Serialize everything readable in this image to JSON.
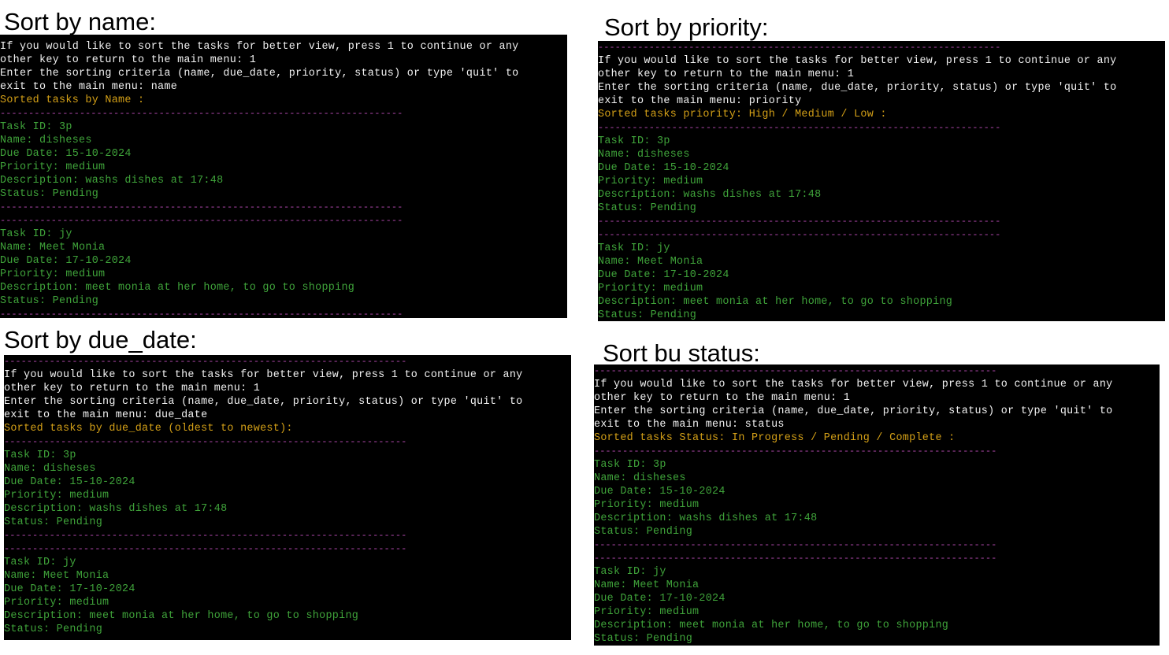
{
  "panels": [
    {
      "id": "name",
      "caption": "Sort by name:",
      "top_separator": false,
      "prompt": [
        "If you would like to sort the tasks for better view, press 1 to continue or any",
        "other key to return to the main menu: 1",
        "Enter the sorting criteria (name, due_date, priority, status) or type 'quit' to",
        "exit to the main menu: name"
      ],
      "header": "Sorted tasks by Name :"
    },
    {
      "id": "priority",
      "caption": "Sort by priority:",
      "top_separator": true,
      "prompt": [
        "If you would like to sort the tasks for better view, press 1 to continue or any",
        "other key to return to the main menu: 1",
        "Enter the sorting criteria (name, due_date, priority, status) or type 'quit' to",
        "exit to the main menu: priority"
      ],
      "header": "Sorted tasks priority: High / Medium / Low :"
    },
    {
      "id": "due_date",
      "caption": "Sort by due_date:",
      "top_separator": true,
      "prompt": [
        "If you would like to sort the tasks for better view, press 1 to continue or any",
        "other key to return to the main menu: 1",
        "Enter the sorting criteria (name, due_date, priority, status) or type 'quit' to",
        "exit to the main menu: due_date"
      ],
      "header": "Sorted tasks by due_date (oldest to newest):"
    },
    {
      "id": "status",
      "caption": "Sort bu status:",
      "top_separator": true,
      "prompt": [
        "If you would like to sort the tasks for better view, press 1 to continue or any",
        "other key to return to the main menu: 1",
        "Enter the sorting criteria (name, due_date, priority, status) or type 'quit' to",
        "exit to the main menu: status"
      ],
      "header": "Sorted tasks Status: In Progress / Pending / Complete :"
    }
  ],
  "tasks": [
    [
      "Task ID: 3p",
      "Name: disheses",
      "Due Date: 15-10-2024",
      "Priority: medium",
      "Description: washs dishes at 17:48",
      "Status: Pending"
    ],
    [
      "Task ID: jy",
      "Name: Meet Monia",
      "Due Date: 17-10-2024",
      "Priority: medium",
      "Description: meet monia at her home, to go to shopping",
      "Status: Pending"
    ]
  ],
  "separator": "-----------------------------------------------------------------------",
  "colors": {
    "background": "#000000",
    "prompt_text": "#f2f2f2",
    "header_text": "#d4a017",
    "separator": "#b54ab0",
    "task_text": "#3fa33a"
  }
}
